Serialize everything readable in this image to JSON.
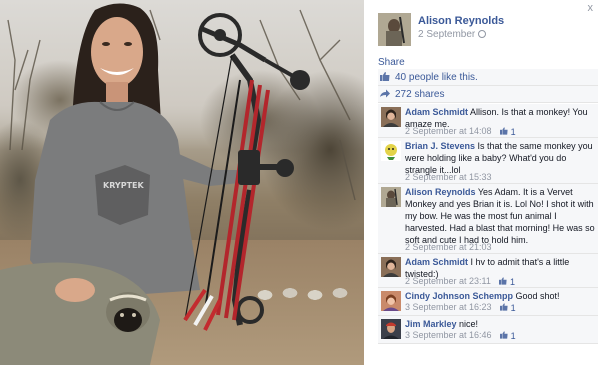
{
  "window": {
    "close_glyph": "x"
  },
  "post": {
    "owner_name": "Alison Reynolds",
    "date": "2 September",
    "share_label": "Share",
    "likes_text": "40 people like this.",
    "shares_text": "272 shares"
  },
  "comments": [
    {
      "name": "Adam Schmidt",
      "text": "Allison. Is that a monkey! You amaze me.",
      "time": "2 September at 14:08",
      "likes": "1",
      "avatar": "woman-avatar"
    },
    {
      "name": "Brian J. Stevens",
      "text": "Is that the same monkey you were holding like a baby? What'd you do strangle it...lol",
      "time": "2 September at 15:33",
      "likes": "",
      "avatar": "cartoon-avatar"
    },
    {
      "name": "Alison Reynolds",
      "text": "Yes Adam. It is a Vervet Monkey and yes Brian it is. Lol No! I shot it with my bow. He was the most fun animal I harvested. Had a blast that morning! He was so soft and cute I had to hold him.",
      "time": "2 September at 21:03",
      "likes": "",
      "avatar": "hunter-avatar"
    },
    {
      "name": "Adam Schmidt",
      "text": "I hv to admit that's a little twisted:)",
      "time": "2 September at 23:11",
      "likes": "1",
      "avatar": "woman-avatar"
    },
    {
      "name": "Cindy Johnson Schempp",
      "text": "Good shot!",
      "time": "3 September at 16:23",
      "likes": "1",
      "avatar": "woman-avatar"
    },
    {
      "name": "Jim Markley",
      "text": "nice!",
      "time": "3 September at 16:46",
      "likes": "1",
      "avatar": "man-avatar"
    }
  ],
  "photo": {
    "shirt_print": "KRYPTEK"
  },
  "colors": {
    "link": "#3b5998",
    "muted": "#9197a3",
    "row_bg": "#f6f7f9",
    "bow_red": "#b3262c"
  }
}
